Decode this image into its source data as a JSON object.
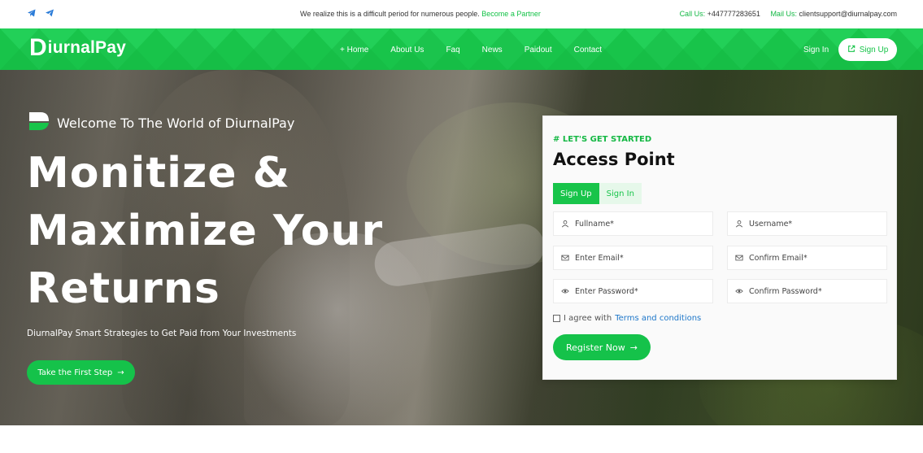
{
  "topbar": {
    "social": [
      {
        "icon": "telegram-icon"
      },
      {
        "icon": "telegram-send-icon"
      }
    ],
    "notice_text": "We realize this is a difficult period for numerous people.",
    "notice_link": "Become a Partner",
    "call_label": "Call Us:",
    "call_value": "+447777283651",
    "mail_label": "Mail Us:",
    "mail_value": "clientsupport@diurnalpay.com"
  },
  "nav": {
    "logo_d": "D",
    "logo_rest": "iurnalPay",
    "items": [
      {
        "label": "+ Home"
      },
      {
        "label": "About Us"
      },
      {
        "label": "Faq"
      },
      {
        "label": "News"
      },
      {
        "label": "Paidout"
      },
      {
        "label": "Contact"
      }
    ],
    "signin": "Sign In",
    "signup": "Sign Up"
  },
  "hero": {
    "welcome": "Welcome To The World of DiurnalPay",
    "headline_1": "Monitize &",
    "headline_2": "Maximize Your",
    "headline_3": "Returns",
    "subline": "DiurnalPay Smart Strategies to Get Paid from Your Investments",
    "cta": "Take the First Step"
  },
  "form": {
    "tag": "# LET'S GET STARTED",
    "title": "Access Point",
    "tab_signup": "Sign Up",
    "tab_signin": "Sign In",
    "fields": [
      {
        "placeholder": "Fullname*",
        "icon": "user-icon"
      },
      {
        "placeholder": "Username*",
        "icon": "user-icon"
      },
      {
        "placeholder": "Enter Email*",
        "icon": "mail-icon"
      },
      {
        "placeholder": "Confirm Email*",
        "icon": "mail-icon"
      },
      {
        "placeholder": "Enter Password*",
        "icon": "eye-icon"
      },
      {
        "placeholder": "Confirm Password*",
        "icon": "eye-icon"
      }
    ],
    "agree_text": "I agree with",
    "agree_link": "Terms and conditions",
    "register": "Register Now",
    "arrow": "→"
  },
  "colors": {
    "brand_green": "#18c44a",
    "link_blue": "#1e77c9"
  }
}
